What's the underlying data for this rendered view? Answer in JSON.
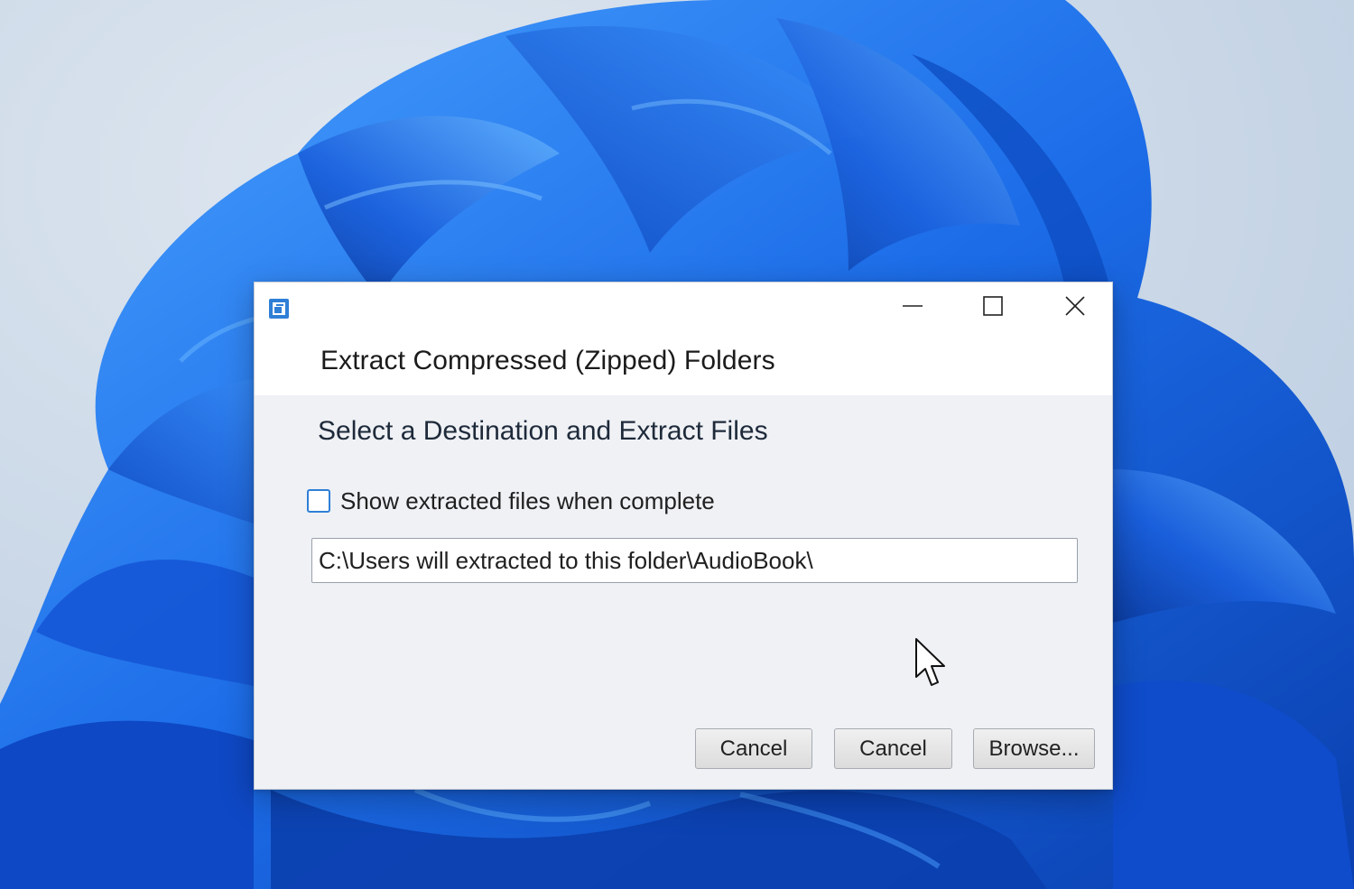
{
  "window": {
    "app_icon": "zip-folder-icon",
    "controls": {
      "minimize_icon": "minimize-icon",
      "maximize_icon": "maximize-icon",
      "close_icon": "close-icon"
    },
    "title": "Extract Compressed (Zipped) Folders"
  },
  "content": {
    "heading": "Select a Destination and Extract Files",
    "show_files_checkbox": {
      "label": "Show extracted files when complete",
      "checked": false
    },
    "destination_path": "C:\\Users will extracted to this folder\\AudioBook\\"
  },
  "buttons": {
    "cancel_1": "Cancel",
    "cancel_2": "Cancel",
    "browse": "Browse..."
  },
  "colors": {
    "accent": "#2f7fd6",
    "wallpaper_blue": "#1f63e0",
    "wallpaper_bg": "#c9d7e6"
  }
}
